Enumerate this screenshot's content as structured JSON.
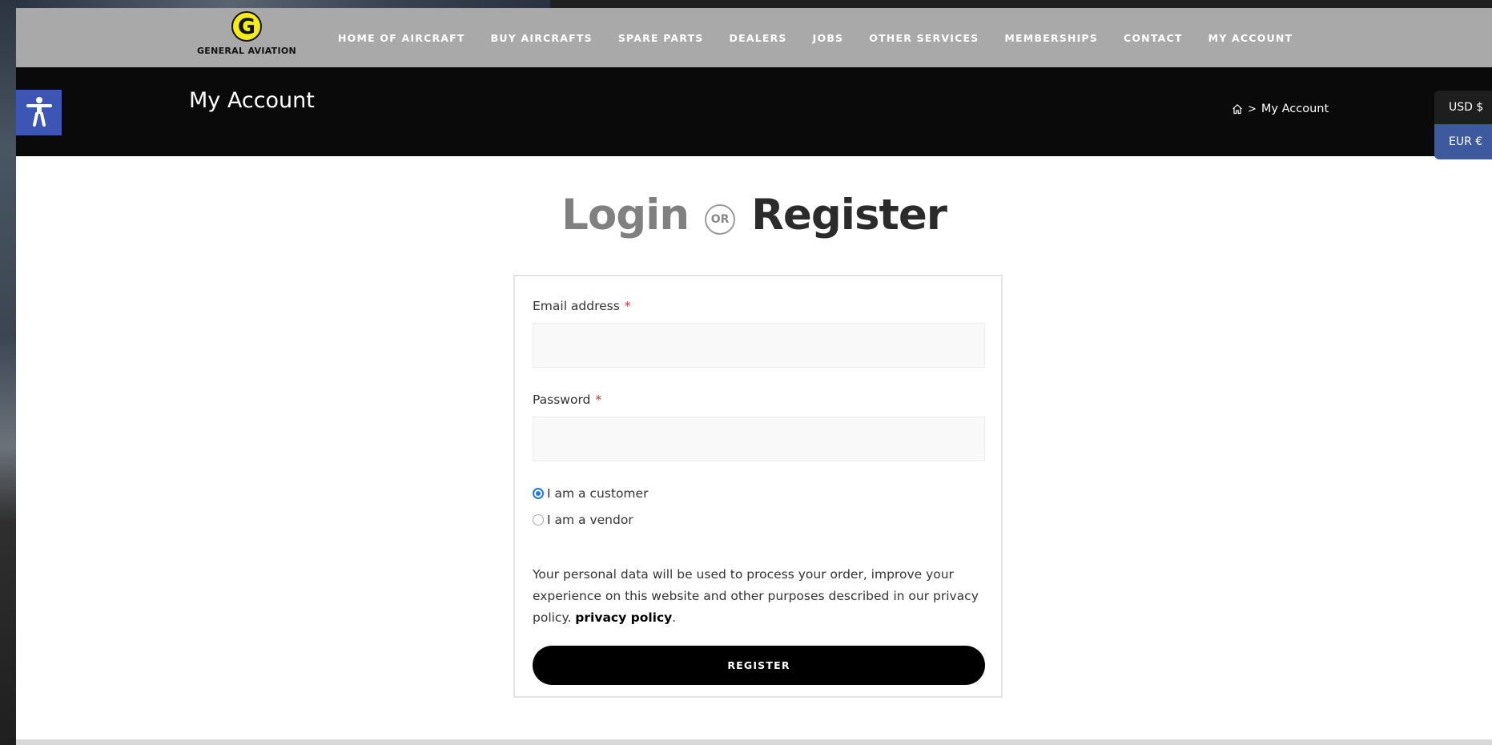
{
  "logo": {
    "letter": "G",
    "text": "GENERAL AVIATION"
  },
  "nav": {
    "items": [
      {
        "label": "HOME OF AIRCRAFT"
      },
      {
        "label": "BUY AIRCRAFTS"
      },
      {
        "label": "SPARE PARTS"
      },
      {
        "label": "DEALERS"
      },
      {
        "label": "JOBS"
      },
      {
        "label": "OTHER SERVICES"
      },
      {
        "label": "MEMBERSHIPS"
      },
      {
        "label": "CONTACT"
      },
      {
        "label": "MY ACCOUNT"
      }
    ]
  },
  "titlebar": {
    "title": "My Account",
    "breadcrumb": {
      "separator": ">",
      "current": "My Account"
    }
  },
  "currency": {
    "usd": "USD $",
    "eur": "EUR €"
  },
  "heading": {
    "login": "Login",
    "or": "OR",
    "register": "Register"
  },
  "form": {
    "email_label": "Email address",
    "email_required": "*",
    "email_value": "",
    "password_label": "Password",
    "password_required": "*",
    "password_value": "",
    "role_customer": "I am a customer",
    "role_vendor": "I am a vendor",
    "role_selected": "customer",
    "privacy_text": "Your personal data will be used to process your order, improve your experience on this website and other purposes described in our privacy policy.",
    "privacy_link": "privacy policy",
    "privacy_end": ".",
    "register_button": "REGISTER"
  },
  "colors": {
    "header_bg": "#a9a9a9",
    "titlebar_bg": "#0a0a0a",
    "accessibility_bg": "#3d55b5",
    "eur_bg": "#3d5a9e",
    "logo_yellow": "#f3ec1b",
    "radio_blue": "#1e78e6"
  },
  "icons": {
    "accessibility": "accessibility-icon",
    "home": "home-icon"
  }
}
